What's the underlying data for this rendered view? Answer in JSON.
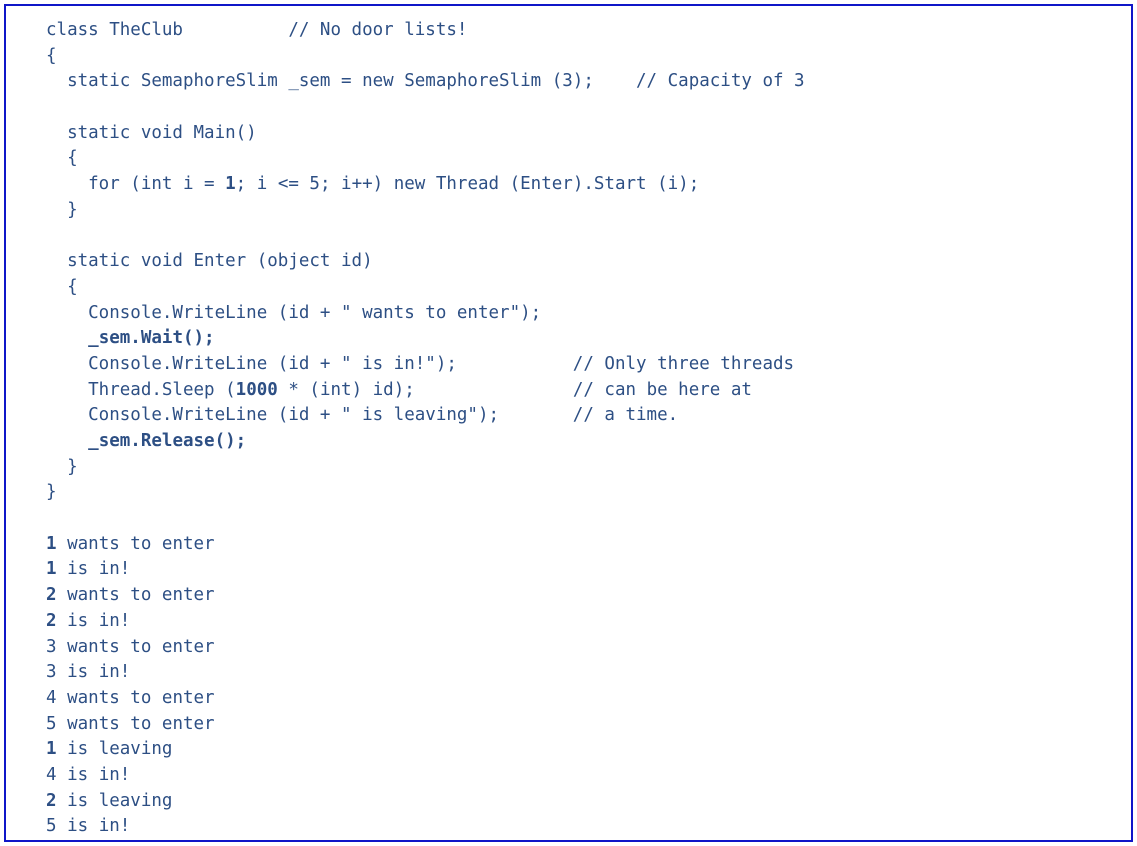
{
  "frame": {
    "border_color": "#0f16c8",
    "text_color": "#2d4f84",
    "background": "#ffffff"
  },
  "code": {
    "language": "csharp",
    "lines": [
      {
        "text": "class TheClub",
        "indent": 0,
        "comment": "// No door lists!",
        "comment_col": 23
      },
      {
        "text": "{",
        "indent": 0
      },
      {
        "text": "  static SemaphoreSlim _sem = new SemaphoreSlim (3);",
        "indent": 0,
        "comment": "// Capacity of 3",
        "comment_col": 56
      },
      {
        "text": "",
        "indent": 0
      },
      {
        "text": "  static void Main()",
        "indent": 0
      },
      {
        "text": "  {",
        "indent": 0
      },
      {
        "text": "    for (int i = 1; i <= 5; i++) new Thread (Enter).Start (i);",
        "indent": 0
      },
      {
        "text": "  }",
        "indent": 0
      },
      {
        "text": "",
        "indent": 0
      },
      {
        "text": "  static void Enter (object id)",
        "indent": 0
      },
      {
        "text": "  {",
        "indent": 0
      },
      {
        "text": "    Console.WriteLine (id + \" wants to enter\");",
        "indent": 0
      },
      {
        "text": "    _sem.Wait();",
        "indent": 0,
        "bold": true
      },
      {
        "text": "    Console.WriteLine (id + \" is in!\");",
        "indent": 0,
        "comment": "// Only three threads",
        "comment_col": 50
      },
      {
        "text": "    Thread.Sleep (1000 * (int) id);",
        "indent": 0,
        "comment": "// can be here at",
        "comment_col": 50
      },
      {
        "text": "    Console.WriteLine (id + \" is leaving\");",
        "indent": 0,
        "comment": "// a time.",
        "comment_col": 50
      },
      {
        "text": "    _sem.Release();",
        "indent": 0,
        "bold": true
      },
      {
        "text": "  }",
        "indent": 0
      },
      {
        "text": "}",
        "indent": 0
      }
    ]
  },
  "output": {
    "lines": [
      {
        "id": "1",
        "message": " wants to enter"
      },
      {
        "id": "1",
        "message": " is in!"
      },
      {
        "id": "2",
        "message": " wants to enter"
      },
      {
        "id": "2",
        "message": " is in!"
      },
      {
        "id": "3",
        "message": " wants to enter"
      },
      {
        "id": "3",
        "message": " is in!"
      },
      {
        "id": "4",
        "message": " wants to enter"
      },
      {
        "id": "5",
        "message": " wants to enter"
      },
      {
        "id": "1",
        "message": " is leaving"
      },
      {
        "id": "4",
        "message": " is in!"
      },
      {
        "id": "2",
        "message": " is leaving"
      },
      {
        "id": "5",
        "message": " is in!"
      }
    ]
  }
}
